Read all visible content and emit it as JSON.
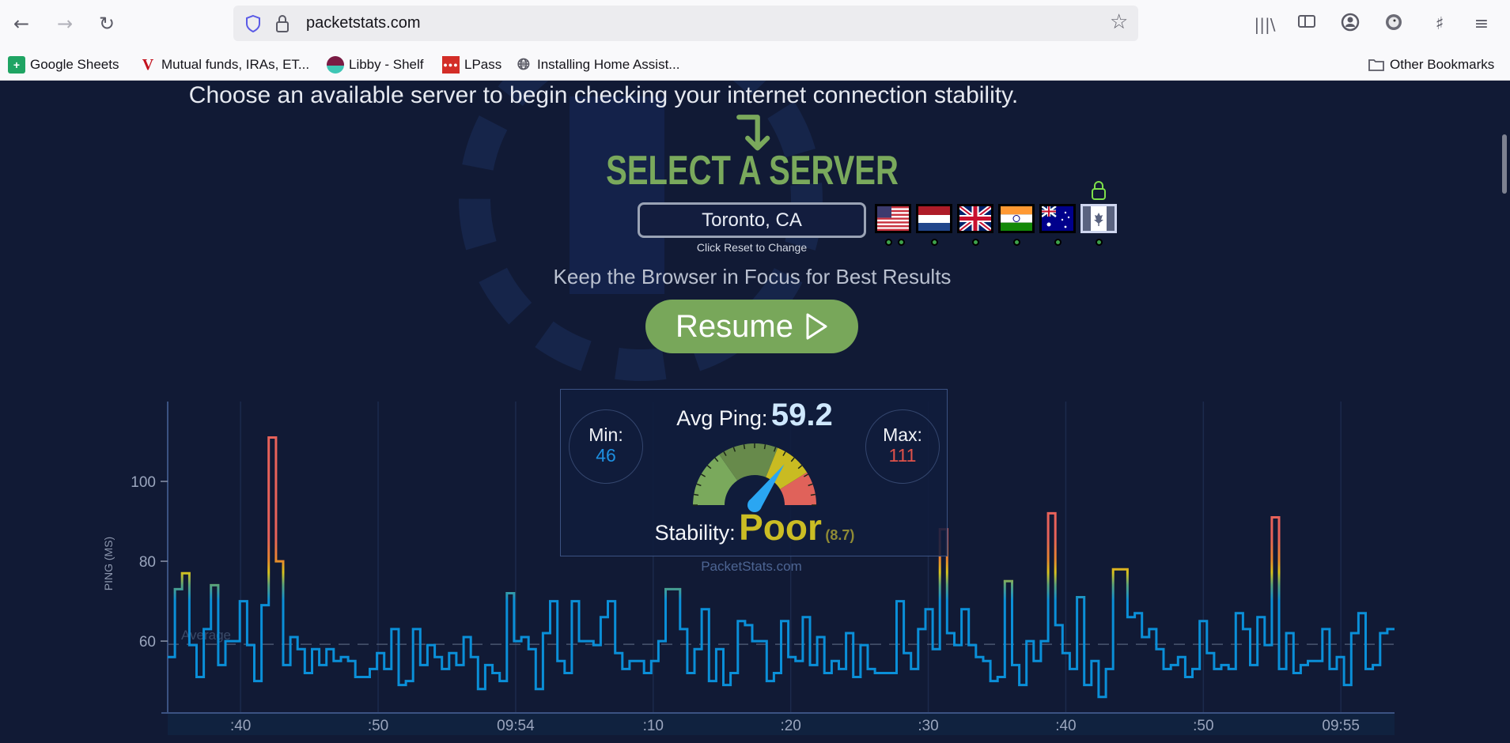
{
  "browser": {
    "url": "packetstats.com",
    "bookmarks": [
      {
        "label": "Google Sheets",
        "icon": "google-sheets-icon"
      },
      {
        "label": "Mutual funds, IRAs, ET...",
        "icon": "vanguard-icon"
      },
      {
        "label": "Libby - Shelf",
        "icon": "libby-icon"
      },
      {
        "label": "LPass",
        "icon": "lastpass-icon"
      },
      {
        "label": "Installing Home Assist...",
        "icon": "globe-icon"
      }
    ],
    "other_bookmarks": "Other Bookmarks"
  },
  "page": {
    "headline": "Choose an available server to begin checking your internet connection stability.",
    "select_title": "SELECT A SERVER",
    "server": {
      "value": "Toronto, CA",
      "hint": "Click Reset to Change"
    },
    "flags": [
      {
        "country": "United States",
        "status_dots": 2
      },
      {
        "country": "Netherlands",
        "status_dots": 1
      },
      {
        "country": "United Kingdom",
        "status_dots": 1
      },
      {
        "country": "India",
        "status_dots": 1
      },
      {
        "country": "Australia",
        "status_dots": 1
      },
      {
        "country": "Canada",
        "status_dots": 1,
        "selected": true,
        "locked": true
      }
    ],
    "focus_note": "Keep the Browser in Focus for Best Results",
    "resume_label": "Resume"
  },
  "stats": {
    "avg_label": "Avg Ping:",
    "avg_value": "59.2",
    "min_label": "Min:",
    "min_value": "46",
    "max_label": "Max:",
    "max_value": "111",
    "stability_label": "Stability:",
    "stability_value": "Poor",
    "stability_score": "(8.7)",
    "gauge_level": 0.7,
    "watermark": "PacketStats.com"
  },
  "colors": {
    "accent_green": "#7aa95c",
    "line_blue": "#0a8fd8",
    "min_blue": "#1d8fe0",
    "max_red": "#e0524a",
    "poor_yellow": "#cbbd24",
    "background": "#111a35"
  },
  "chart_data": {
    "type": "line",
    "step": true,
    "ylabel": "PING (MS)",
    "ylim": [
      42,
      120
    ],
    "yticks": [
      60,
      80,
      100
    ],
    "x_range": [
      "09:53:34.7",
      "09:55:03.9"
    ],
    "xticks": [
      {
        "label": ":40",
        "time": "09:53:40"
      },
      {
        "label": ":50",
        "time": "09:53:50"
      },
      {
        "label": "09:54",
        "time": "09:54:00"
      },
      {
        "label": ":10",
        "time": "09:54:10"
      },
      {
        "label": ":20",
        "time": "09:54:20"
      },
      {
        "label": ":30",
        "time": "09:54:30"
      },
      {
        "label": ":40",
        "time": "09:54:40"
      },
      {
        "label": ":50",
        "time": "09:54:50"
      },
      {
        "label": "09:55",
        "time": "09:55:00"
      }
    ],
    "grid": "vertical",
    "average": {
      "label": "Average",
      "value": 59.2
    },
    "values": [
      56,
      73,
      77,
      59,
      51,
      63,
      74,
      54,
      60,
      60,
      70,
      59,
      50,
      69,
      111,
      80,
      54,
      61,
      58,
      52,
      58,
      54,
      58,
      55,
      56,
      55,
      51,
      51,
      53,
      57,
      53,
      63,
      49,
      50,
      63,
      54,
      59,
      56,
      53,
      57,
      54,
      61,
      56,
      48,
      54,
      52,
      50,
      72,
      60,
      61,
      58,
      48,
      62,
      70,
      55,
      52,
      70,
      60,
      60,
      59,
      66,
      70,
      57,
      53,
      55,
      55,
      52,
      55,
      60,
      73,
      73,
      63,
      52,
      58,
      68,
      50,
      58,
      49,
      52,
      65,
      64,
      60,
      60,
      50,
      52,
      65,
      56,
      55,
      66,
      54,
      61,
      52,
      55,
      53,
      62,
      51,
      59,
      53,
      52,
      52,
      52,
      70,
      57,
      53,
      63,
      68,
      58,
      88,
      62,
      59,
      68,
      59,
      56,
      55,
      50,
      51,
      75,
      54,
      49,
      60,
      55,
      60,
      92,
      64,
      57,
      53,
      71,
      49,
      55,
      46,
      53,
      78,
      78,
      66,
      67,
      61,
      63,
      58,
      53,
      54,
      56,
      51,
      53,
      65,
      57,
      53,
      54,
      53,
      67,
      63,
      54,
      66,
      59,
      91,
      53,
      62,
      52,
      54,
      55,
      55,
      63,
      53,
      56,
      49,
      62,
      67,
      53,
      54,
      62,
      63
    ]
  }
}
